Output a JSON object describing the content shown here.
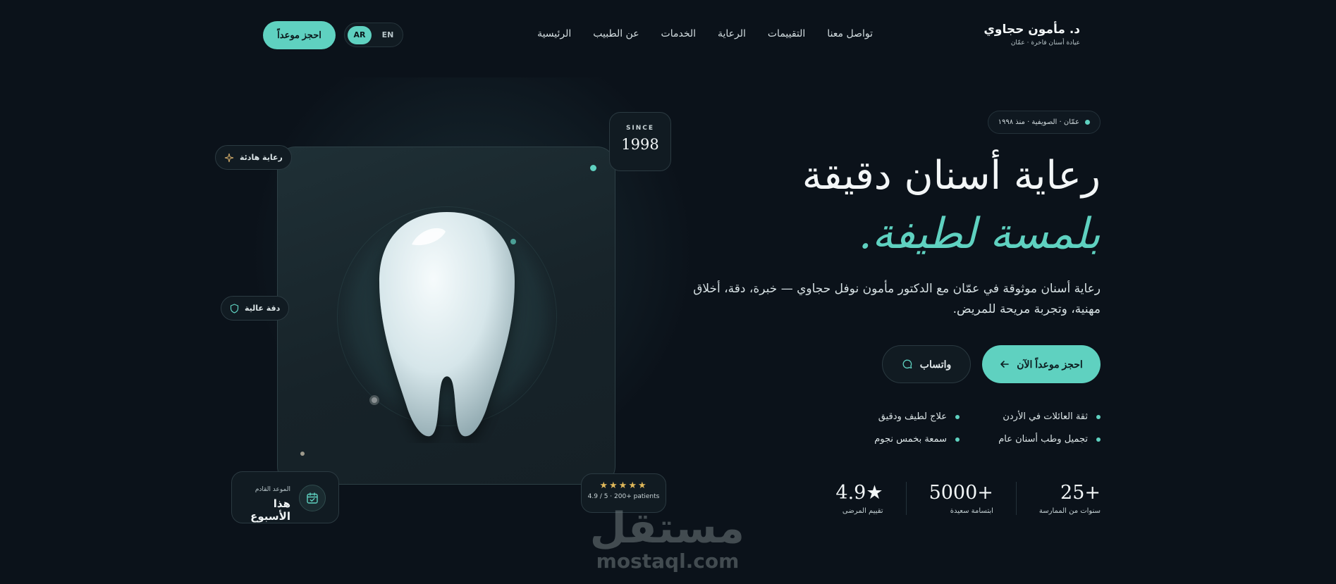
{
  "brand": {
    "name": "د. مأمون حجاوي",
    "subtitle": "عيادة أسنان فاخرة · عمّان"
  },
  "nav": {
    "items": [
      "الرئيسية",
      "عن الطبيب",
      "الخدمات",
      "الرعاية",
      "التقييمات",
      "تواصل معنا"
    ],
    "lang_options": [
      "AR",
      "EN"
    ],
    "active_lang": "AR",
    "cta": "احجز موعداً"
  },
  "hero": {
    "location_pill": "عمّان · الصويفية · منذ ١٩٩٨",
    "headline_1": "رعاية أسنان دقيقة",
    "headline_2": "بلمسة لطيفة.",
    "description": "رعاية أسنان موثوقة في عمّان مع الدكتور مأمون نوفل حجاوي — خبرة، دقة، أخلاق مهنية، وتجربة مريحة للمريض.",
    "primary_cta": "احجز موعداً الآن",
    "secondary_cta": "واتساب",
    "features": [
      "ثقة العائلات في الأردن",
      "علاج لطيف ودقيق",
      "تجميل وطب أسنان عام",
      "سمعة بخمس نجوم"
    ],
    "stats": [
      {
        "value": "25+",
        "label": "سنوات من الممارسة"
      },
      {
        "value": "5000+",
        "label": "ابتسامة سعيدة"
      },
      {
        "value": "4.9★",
        "label": "تقييم المرضى"
      }
    ]
  },
  "card": {
    "since_label": "SINCE",
    "since_year": "1998",
    "chip_calm": "رعاية هادئة",
    "chip_precise": "دقة عالية",
    "appointment_label": "الموعد القادم",
    "appointment_value": "هذا الأسبوع",
    "rating_stars": "★★★★★",
    "rating_text": "4.9 / 5 · 200+ patients"
  },
  "watermark": {
    "arabic": "مستقل",
    "latin": "mostaql.com"
  },
  "colors": {
    "accent": "#5fd1c0",
    "background": "#0b121a",
    "star": "#e0b85a"
  }
}
